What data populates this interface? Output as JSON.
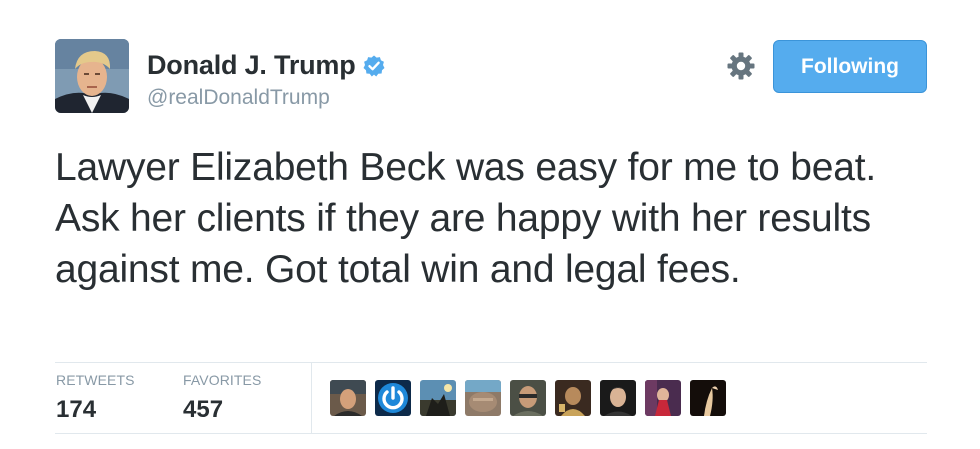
{
  "author": {
    "display_name": "Donald J. Trump",
    "handle": "@realDonaldTrump",
    "verified": true,
    "avatar_icon": "profile-photo"
  },
  "actions": {
    "follow_label": "Following",
    "settings_icon": "gear-icon"
  },
  "tweet": {
    "text": "Lawyer Elizabeth Beck was easy for me to beat. Ask her clients if they are happy with her results against me. Got total win and legal fees."
  },
  "stats": {
    "retweets_label": "RETWEETS",
    "retweets_value": "174",
    "favorites_label": "FAVORITES",
    "favorites_value": "457"
  },
  "favoriters": [
    {
      "icon": "user-avatar"
    },
    {
      "icon": "power-icon-avatar"
    },
    {
      "icon": "user-avatar"
    },
    {
      "icon": "user-avatar"
    },
    {
      "icon": "user-avatar"
    },
    {
      "icon": "user-avatar"
    },
    {
      "icon": "user-avatar"
    },
    {
      "icon": "user-avatar"
    },
    {
      "icon": "user-avatar"
    }
  ],
  "colors": {
    "accent": "#55acee",
    "verified": "#55acee",
    "text": "#292f33",
    "muted": "#8899a6",
    "divider": "#e1e8ed"
  }
}
